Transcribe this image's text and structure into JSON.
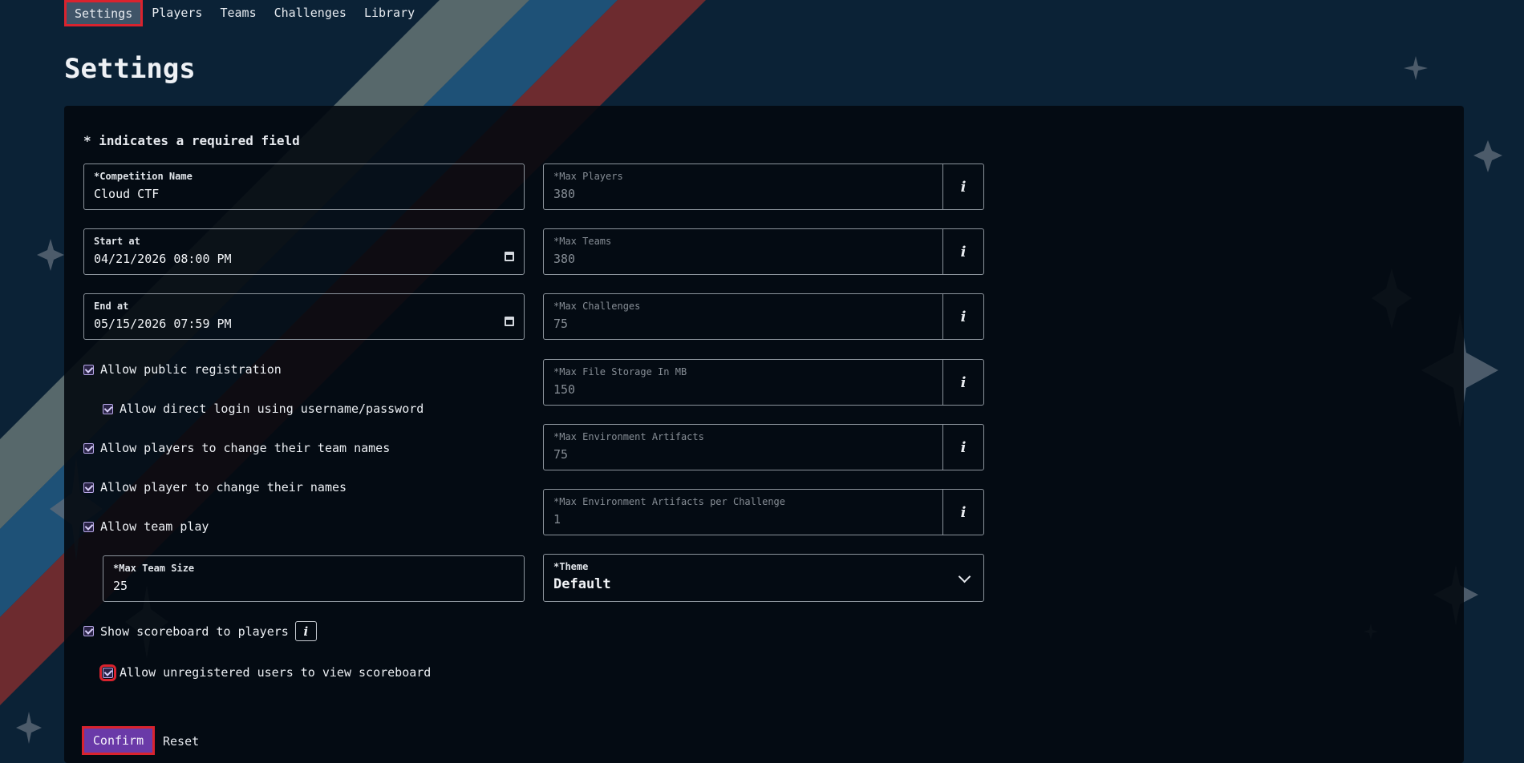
{
  "nav": {
    "items": [
      {
        "label": "Settings",
        "active": true
      },
      {
        "label": "Players"
      },
      {
        "label": "Teams"
      },
      {
        "label": "Challenges"
      },
      {
        "label": "Library"
      }
    ]
  },
  "page": {
    "title": "Settings",
    "required_note": "* indicates a required field"
  },
  "left_fields": {
    "competition_name": {
      "label": "Competition Name",
      "value": "Cloud CTF"
    },
    "start_at": {
      "label": "Start at",
      "value": "04/21/2026 08:00 PM"
    },
    "end_at": {
      "label": "End at",
      "value": "05/15/2026 07:59 PM"
    },
    "max_team_size": {
      "label": "Max Team Size",
      "value": "25"
    }
  },
  "checkboxes": {
    "public_registration": "Allow public registration",
    "direct_login": "Allow direct login using username/password",
    "change_team_names": "Allow players to change their team names",
    "change_names": "Allow player to change their names",
    "team_play": "Allow team play",
    "show_scoreboard": "Show scoreboard to players",
    "unregistered_scoreboard": "Allow unregistered users to view scoreboard"
  },
  "right_fields": {
    "max_players": {
      "label": "Max Players",
      "value": "380"
    },
    "max_teams": {
      "label": "Max Teams",
      "value": "380"
    },
    "max_challenges": {
      "label": "Max Challenges",
      "value": "75"
    },
    "max_file_storage": {
      "label": "Max File Storage In MB",
      "value": "150"
    },
    "max_env_artifacts": {
      "label": "Max Environment Artifacts",
      "value": "75"
    },
    "max_env_artifacts_per_challenge": {
      "label": "Max Environment Artifacts per Challenge",
      "value": "1"
    },
    "theme": {
      "label": "Theme",
      "value": "Default"
    }
  },
  "common": {
    "required_mark": "*",
    "info_glyph": "i"
  },
  "buttons": {
    "confirm": "Confirm",
    "reset": "Reset"
  },
  "colors": {
    "accent": "#6a3aa8",
    "highlight": "#d9232e",
    "background": "#0b2236"
  }
}
